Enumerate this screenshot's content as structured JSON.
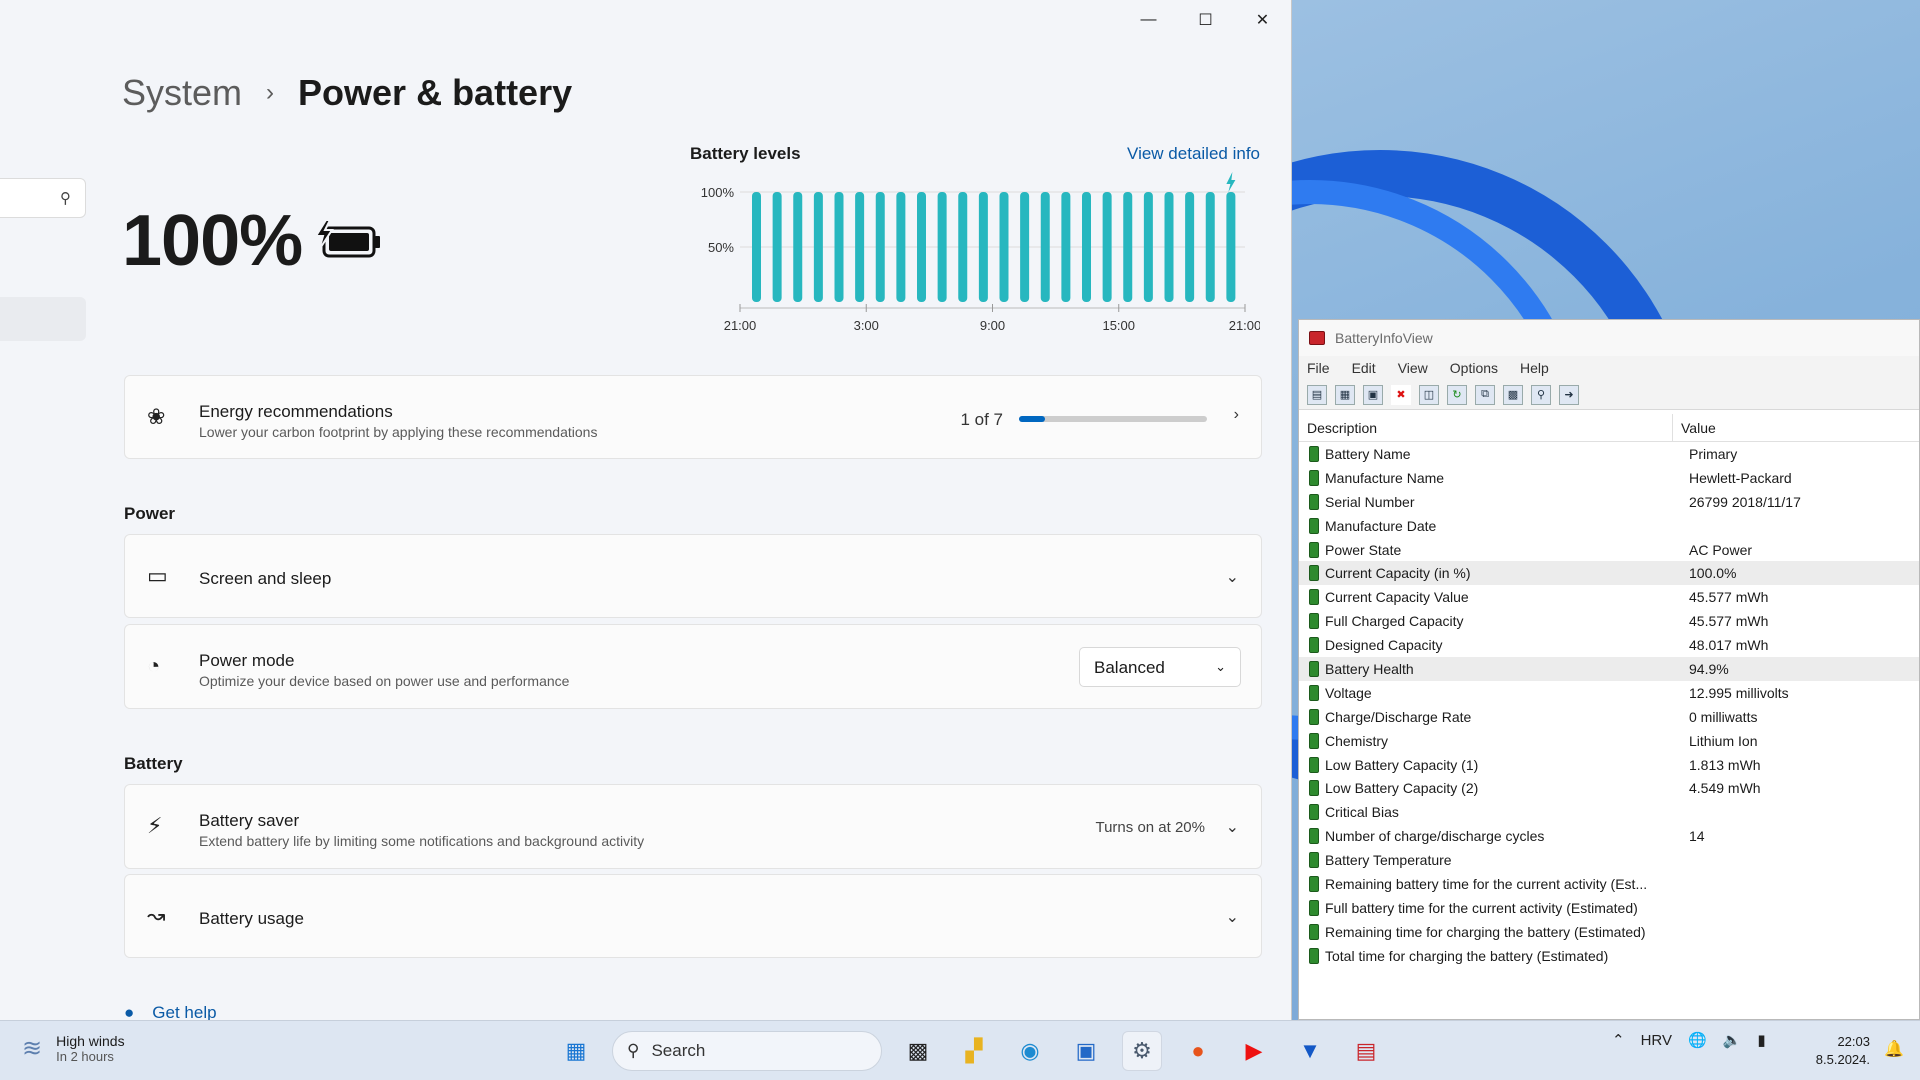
{
  "settings": {
    "breadcrumb_parent": "System",
    "breadcrumb_current": "Power & battery",
    "battery_percent": "100%",
    "chart": {
      "title": "Battery levels",
      "link": "View detailed info"
    },
    "energy": {
      "title": "Energy recommendations",
      "subtitle": "Lower your carbon footprint by applying these recommendations",
      "counter": "1 of 7",
      "progress_fraction": 0.14
    },
    "power_section": "Power",
    "screen_sleep": {
      "title": "Screen and sleep"
    },
    "power_mode": {
      "title": "Power mode",
      "subtitle": "Optimize your device based on power use and performance",
      "value": "Balanced"
    },
    "battery_section": "Battery",
    "battery_saver": {
      "title": "Battery saver",
      "subtitle": "Extend battery life by limiting some notifications and background activity",
      "status": "Turns on at 20%"
    },
    "battery_usage": {
      "title": "Battery usage"
    },
    "get_help": "Get help"
  },
  "chart_data": {
    "type": "bar",
    "title": "Battery levels",
    "y_ticks": [
      "100%",
      "50%"
    ],
    "x_ticks": [
      "21:00",
      "3:00",
      "9:00",
      "15:00",
      "21:00"
    ],
    "ylim": [
      0,
      100
    ],
    "values": [
      100,
      100,
      100,
      100,
      100,
      100,
      100,
      100,
      100,
      100,
      100,
      100,
      100,
      100,
      100,
      100,
      100,
      100,
      100,
      100,
      100,
      100,
      100,
      100
    ],
    "color": "#27b7bf",
    "charging_marker": true
  },
  "biv": {
    "title": "BatteryInfoView",
    "menu": [
      "File",
      "Edit",
      "View",
      "Options",
      "Help"
    ],
    "col_desc": "Description",
    "col_value": "Value",
    "rows": [
      {
        "d": "Battery Name",
        "v": "Primary"
      },
      {
        "d": "Manufacture Name",
        "v": "Hewlett-Packard"
      },
      {
        "d": "Serial Number",
        "v": "26799 2018/11/17"
      },
      {
        "d": "Manufacture Date",
        "v": ""
      },
      {
        "d": "Power State",
        "v": "AC Power"
      },
      {
        "d": "Current Capacity (in %)",
        "v": "100.0%"
      },
      {
        "d": "Current Capacity Value",
        "v": "45.577 mWh"
      },
      {
        "d": "Full Charged Capacity",
        "v": "45.577 mWh"
      },
      {
        "d": "Designed Capacity",
        "v": "48.017 mWh"
      },
      {
        "d": "Battery Health",
        "v": "94.9%"
      },
      {
        "d": "Voltage",
        "v": "12.995 millivolts"
      },
      {
        "d": "Charge/Discharge Rate",
        "v": "0 milliwatts"
      },
      {
        "d": "Chemistry",
        "v": "Lithium Ion"
      },
      {
        "d": "Low Battery Capacity (1)",
        "v": "1.813 mWh"
      },
      {
        "d": "Low Battery Capacity (2)",
        "v": "4.549 mWh"
      },
      {
        "d": "Critical Bias",
        "v": ""
      },
      {
        "d": "Number of charge/discharge cycles",
        "v": "14"
      },
      {
        "d": "Battery Temperature",
        "v": ""
      },
      {
        "d": "Remaining battery time for the current activity (Est...",
        "v": ""
      },
      {
        "d": "Full battery time for the current activity (Estimated)",
        "v": ""
      },
      {
        "d": "Remaining time for charging the battery (Estimated)",
        "v": ""
      },
      {
        "d": "Total  time for charging the battery (Estimated)",
        "v": ""
      }
    ]
  },
  "taskbar": {
    "weather_title": "High winds",
    "weather_sub": "In 2 hours",
    "search": "Search",
    "lang": "HRV",
    "time": "22:03",
    "date": "8.5.2024."
  }
}
